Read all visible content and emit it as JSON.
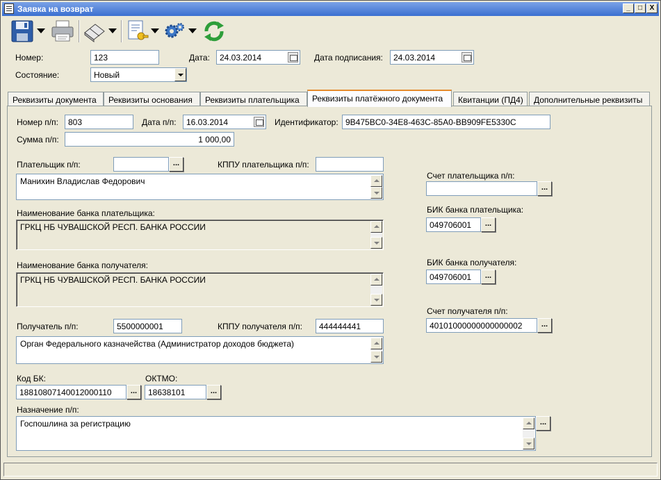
{
  "window": {
    "title": "Заявка на возврат",
    "buttons": {
      "minimize": "_",
      "maximize": "□",
      "close": "X"
    }
  },
  "toolbar": {
    "icons": [
      "save-icon",
      "print-icon",
      "eraser-icon",
      "document-key-icon",
      "settings-gears-icon",
      "refresh-icon"
    ]
  },
  "header": {
    "number_label": "Номер:",
    "number_value": "123",
    "date_label": "Дата:",
    "date_value": "24.03.2014",
    "sign_date_label": "Дата подписания:",
    "sign_date_value": "24.03.2014",
    "state_label": "Состояние:",
    "state_value": "Новый"
  },
  "tabs": [
    {
      "label": "Реквизиты документа",
      "active": false
    },
    {
      "label": "Реквизиты основания",
      "active": false
    },
    {
      "label": "Реквизиты плательщика",
      "active": false
    },
    {
      "label": "Реквизиты платёжного документа",
      "active": true
    },
    {
      "label": "Квитанции (ПД4)",
      "active": false
    },
    {
      "label": "Дополнительные реквизиты",
      "active": false
    }
  ],
  "form": {
    "pp_number_label": "Номер п/п:",
    "pp_number_value": "803",
    "pp_date_label": "Дата п/п:",
    "pp_date_value": "16.03.2014",
    "identifier_label": "Идентификатор:",
    "identifier_value": "9B475BC0-34E8-463C-85A0-BB909FE5330C",
    "sum_label": "Сумма п/п:",
    "sum_value": "1 000,00",
    "payer_label": "Плательщик п/п:",
    "payer_value": "",
    "payer_kppu_label": "КППУ плательщика п/п:",
    "payer_kppu_value": "",
    "payer_name": "Манихин Владислав Федорович",
    "payer_bank_label": "Наименование банка плательщика:",
    "payer_bank_value": "ГРКЦ НБ ЧУВАШСКОЙ РЕСП. БАНКА РОССИИ",
    "receiver_bank_label": "Наименование банка получателя:",
    "receiver_bank_value": "ГРКЦ НБ ЧУВАШСКОЙ РЕСП. БАНКА РОССИИ",
    "receiver_label": "Получатель п/п:",
    "receiver_value": "5500000001",
    "receiver_kppu_label": "КППУ получателя п/п:",
    "receiver_kppu_value": "444444441",
    "receiver_name": "Орган Федерального казначейства (Администратор доходов бюджета)",
    "kbk_label": "Код БК:",
    "kbk_value": "18810807140012000110",
    "oktmo_label": "ОКТМО:",
    "oktmo_value": "18638101",
    "purpose_label": "Назначение п/п:",
    "purpose_value": "Госпошлина за регистрацию",
    "payer_account_label": "Счет плательщика п/п:",
    "payer_account_value": "",
    "payer_bik_label": "БИК банка плательщика:",
    "payer_bik_value": "049706001",
    "receiver_bik_label": "БИК банка получателя:",
    "receiver_bik_value": "049706001",
    "receiver_account_label": "Счет получателя п/п:",
    "receiver_account_value": "40101000000000000002",
    "dots": "..."
  },
  "colors": {
    "title_bar": "#3A6FD0",
    "active_tab_accent": "#E68B2C",
    "field_border": "#7F9DB9"
  }
}
